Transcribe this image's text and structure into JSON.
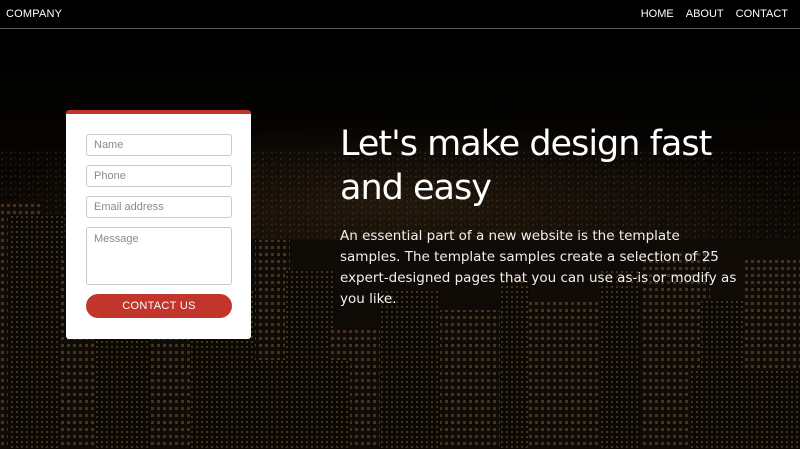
{
  "nav": {
    "brand": "COMPANY",
    "links": [
      "HOME",
      "ABOUT",
      "CONTACT"
    ]
  },
  "contact_form": {
    "name_placeholder": "Name",
    "phone_placeholder": "Phone",
    "email_placeholder": "Email address",
    "message_placeholder": "Message",
    "submit_label": "CONTACT US"
  },
  "hero": {
    "title": "Let's make design fast and easy",
    "text": "An essential part of a new website is the template samples. The template samples create a selection of 25 expert-designed pages that you can use as-is or modify as you like."
  },
  "colors": {
    "accent": "#c1352a",
    "navbar": "#000000",
    "card": "#ffffff"
  }
}
